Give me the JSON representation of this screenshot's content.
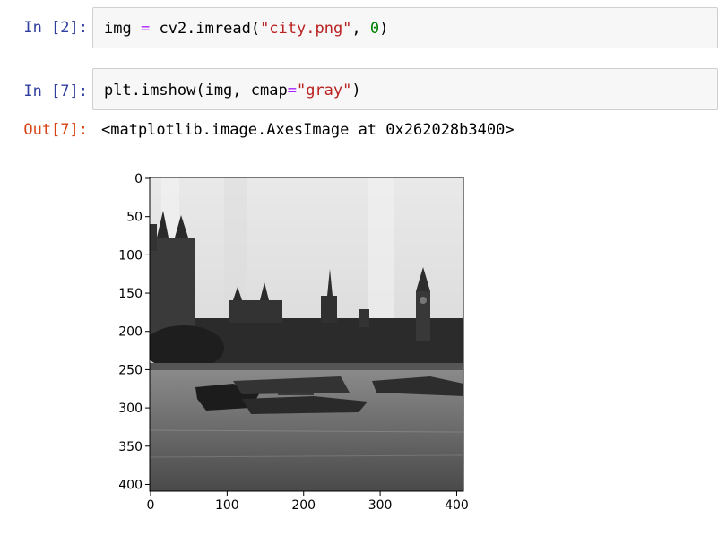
{
  "cells": [
    {
      "prompt": "In [2]:",
      "code": {
        "var": "img",
        "op": "=",
        "call": "cv2.imread(",
        "arg_str": "\"city.png\"",
        "sep": ", ",
        "arg_num": "0",
        "close": ")"
      }
    },
    {
      "prompt": "In [7]:",
      "code": {
        "pre": "plt.imshow(img, cmap",
        "op": "=",
        "arg_str": "\"gray\"",
        "close": ")"
      },
      "out_prompt": "Out[7]:",
      "output": "<matplotlib.image.AxesImage at 0x262028b3400>"
    }
  ],
  "plot": {
    "y_ticks": [
      "0",
      "50",
      "100",
      "150",
      "200",
      "250",
      "300",
      "350",
      "400"
    ],
    "x_ticks": [
      "0",
      "100",
      "200",
      "300",
      "400"
    ]
  },
  "colors": {
    "in_prompt": "#303f9f",
    "out_prompt": "#d84315",
    "operator": "#aa22ff",
    "string": "#ba2121",
    "number": "#008000"
  }
}
